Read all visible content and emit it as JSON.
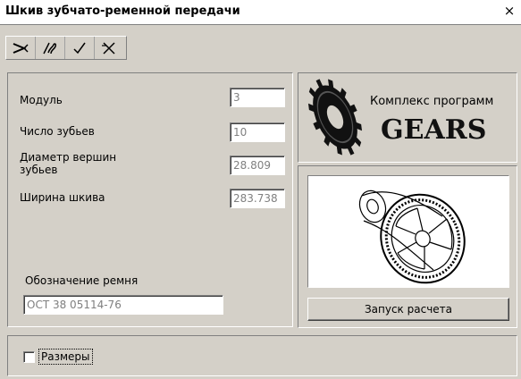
{
  "window": {
    "title": "Шкив зубчато-ременной передачи",
    "close_label": "×"
  },
  "toolbar": {
    "buttons": [
      {
        "name": "arrow-tool-icon"
      },
      {
        "name": "edit-pen-icon"
      },
      {
        "name": "check-icon"
      },
      {
        "name": "cross-tool-icon"
      }
    ]
  },
  "params": {
    "module_label": "Модуль",
    "module_value": "3",
    "teeth_label": "Число зубьев",
    "teeth_value": "10",
    "tip_diameter_label_line1": "Диаметр вершин",
    "tip_diameter_label_line2": "зубьев",
    "tip_diameter_value": "28.809",
    "width_label": "Ширина шкива",
    "width_value": "283.738",
    "belt_label": "Обозначение ремня",
    "belt_value": "ОСТ 38 05114-76"
  },
  "logo": {
    "line1": "Комплекс программ",
    "line2": "GEARS"
  },
  "actions": {
    "run_button": "Запуск расчета"
  },
  "options": {
    "dimensions_label": "Размеры",
    "dimensions_checked": false
  }
}
